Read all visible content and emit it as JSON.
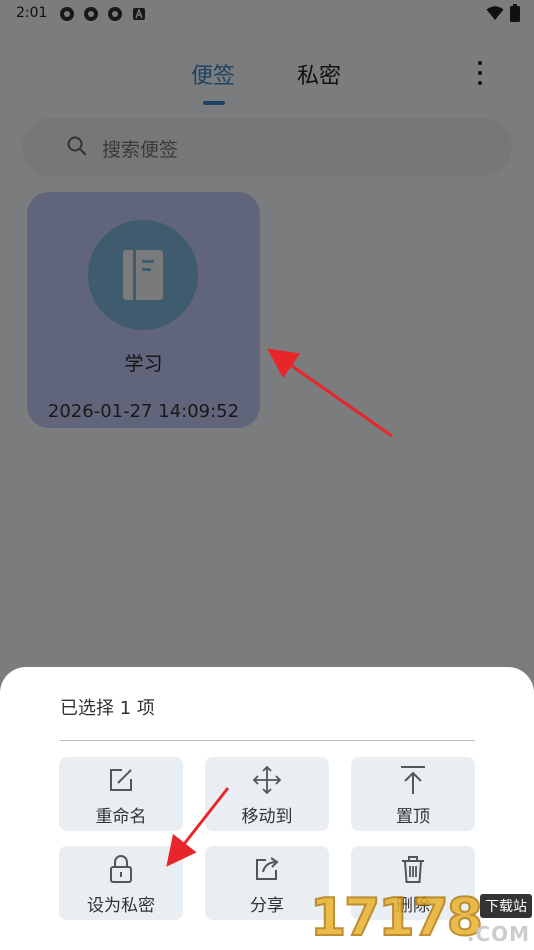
{
  "status_bar": {
    "time": "2:01",
    "left_icons": [
      "tracking-icon",
      "tracking-icon",
      "tracking-icon",
      "a-icon"
    ],
    "right_icons": [
      "wifi-icon",
      "battery-icon"
    ]
  },
  "header": {
    "tabs": [
      {
        "label": "便签",
        "active": true
      },
      {
        "label": "私密",
        "active": false
      }
    ],
    "accent": "#3a86c8"
  },
  "search": {
    "placeholder": "搜索便签"
  },
  "notes": [
    {
      "title": "学习",
      "time": "2026-01-27 14:09:52",
      "icon": "notebook-icon",
      "card_color": "#c3cbf6"
    }
  ],
  "sheet": {
    "title": "已选择 1 项",
    "actions": [
      {
        "label": "重命名",
        "icon": "edit-icon"
      },
      {
        "label": "移动到",
        "icon": "move-icon"
      },
      {
        "label": "置顶",
        "icon": "pin-top-icon"
      },
      {
        "label": "设为私密",
        "icon": "lock-icon"
      },
      {
        "label": "分享",
        "icon": "share-icon"
      },
      {
        "label": "删除",
        "icon": "delete-icon"
      }
    ]
  },
  "watermark": {
    "digits": "17178",
    "badge": "下载站",
    "domain": ".COM"
  }
}
